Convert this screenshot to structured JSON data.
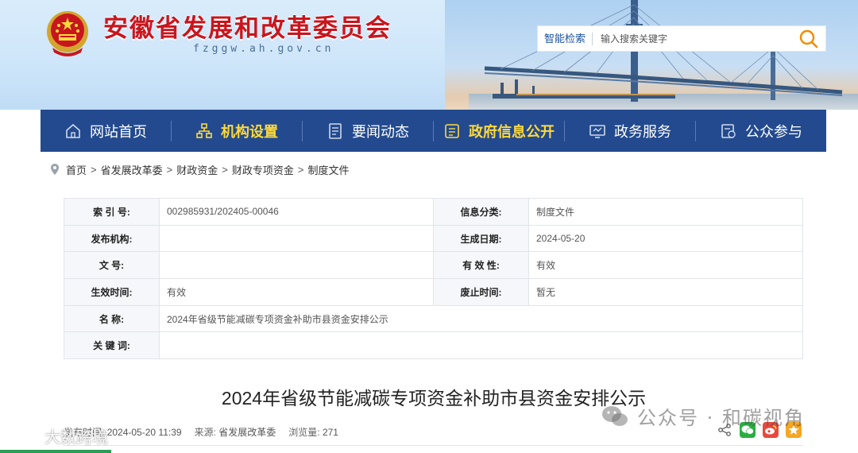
{
  "header": {
    "site_title": "安徽省发展和改革委员会",
    "site_domain": "fzggw.ah.gov.cn",
    "search": {
      "label": "智能检索",
      "placeholder": "输入搜索关键字"
    }
  },
  "nav": {
    "items": [
      {
        "label": "网站首页",
        "icon": "home-icon"
      },
      {
        "label": "机构设置",
        "icon": "org-chart-icon"
      },
      {
        "label": "要闻动态",
        "icon": "news-icon"
      },
      {
        "label": "政府信息公开",
        "icon": "gov-info-icon"
      },
      {
        "label": "政务服务",
        "icon": "monitor-icon"
      },
      {
        "label": "公众参与",
        "icon": "participation-icon"
      }
    ]
  },
  "breadcrumb": [
    "首页",
    "省发展改革委",
    "财政资金",
    "财政专项资金",
    "制度文件"
  ],
  "info": {
    "index_no_label": "索 引 号:",
    "index_no": "002985931/202405-00046",
    "category_label": "信息分类:",
    "category": "制度文件",
    "publisher_label": "发布机构:",
    "publisher": "",
    "date_label": "生成日期:",
    "date": "2024-05-20",
    "doc_no_label": "文      号:",
    "doc_no": "",
    "validity_label": "有 效 性:",
    "validity": "有效",
    "effective_label": "生效时间:",
    "effective": "有效",
    "expire_label": "废止时间:",
    "expire": "暂无",
    "name_label": "名      称:",
    "name": "2024年省级节能减碳专项资金补助市县资金安排公示",
    "keywords_label": "关 键 词:",
    "keywords": ""
  },
  "article": {
    "title": "2024年省级节能减碳专项资金补助市县资金安排公示",
    "publish_label": "发布时间:",
    "publish_time": "2024-05-20 11:39",
    "source_label": "来源:",
    "source": "省发展改革委",
    "views_label": "浏览量:",
    "views": "271"
  },
  "watermarks": {
    "wechat": "公众号 · 和碳视角",
    "left": "大数跨境"
  },
  "colors": {
    "nav_bg": "#234a8f",
    "title_red": "#c8161e",
    "nav_highlight": "#ffd93b",
    "search_orange": "#f08c00"
  }
}
